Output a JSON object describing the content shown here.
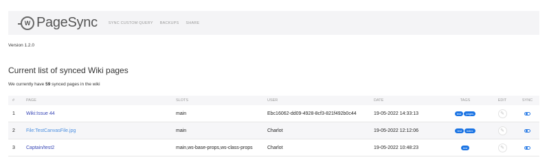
{
  "header": {
    "logo_badge": "W",
    "logo_text": "PageSync",
    "nav": [
      "SYNC CUSTOM QUERY",
      "BACKUPS",
      "SHARE"
    ]
  },
  "version_text": "Version 1.2.0",
  "heading": "Current list of synced Wiki pages",
  "summary": {
    "prefix": "We currently have ",
    "count": "59",
    "suffix": " synced pages in the wiki"
  },
  "table": {
    "columns": [
      "#",
      "PAGE",
      "SLOTS",
      "USER",
      "DATE",
      "TAGS",
      "EDIT",
      "SYNC"
    ],
    "rows": [
      {
        "num": "1",
        "page": "Wiki:Issue 44",
        "slots": "main",
        "user": "Ebc16062-dd09-4928-8cf3-821f492b0c44",
        "date": "19-05-2022 14:33:13",
        "tags": [
          "test",
          "pages"
        ]
      },
      {
        "num": "2",
        "page": "File:TestCanvasFile.jpg",
        "slots": "main",
        "user": "Charlot",
        "date": "19-05-2022 12:12:06",
        "tags": [
          "test",
          "index"
        ]
      },
      {
        "num": "3",
        "page": "Captain/test2",
        "slots": "main,ws-base-props,ws-class-props",
        "user": "Charlot",
        "date": "19-05-2022 10:48:23",
        "tags": [
          "test"
        ]
      }
    ]
  },
  "icons": {
    "edit": "pencil-icon",
    "sync": "toggle-icon",
    "logo": "pagesync-logo-icon"
  },
  "colors": {
    "link": "#3645b5",
    "link_visited": "#4b8fe0",
    "tag": "#1b74e4",
    "toggle": "#2b7ce6"
  }
}
